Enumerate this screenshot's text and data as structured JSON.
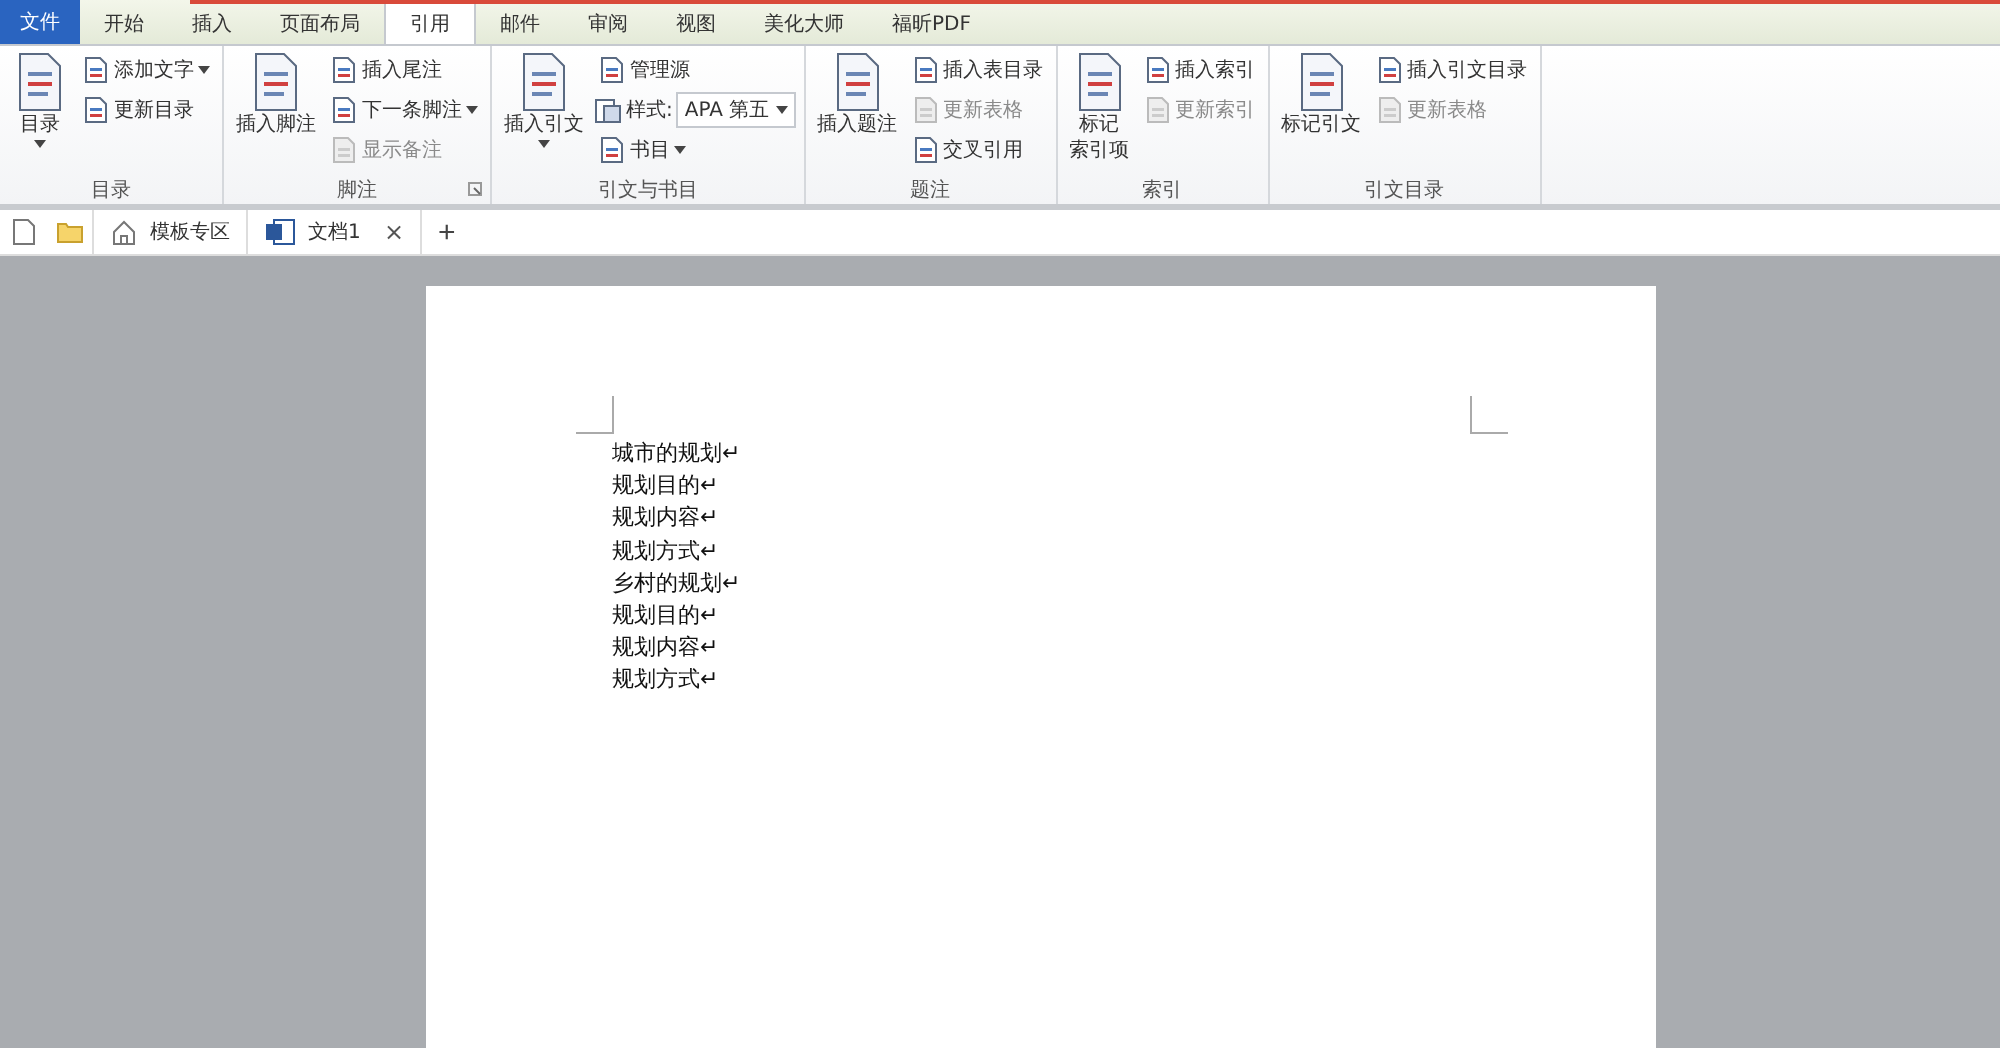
{
  "tabs": [
    {
      "label": "文件",
      "kind": "file",
      "selected": false
    },
    {
      "label": "开始",
      "kind": "tab",
      "selected": false
    },
    {
      "label": "插入",
      "kind": "tab",
      "selected": false
    },
    {
      "label": "页面布局",
      "kind": "tab",
      "selected": false
    },
    {
      "label": "引用",
      "kind": "tab",
      "selected": true
    },
    {
      "label": "邮件",
      "kind": "tab",
      "selected": false
    },
    {
      "label": "审阅",
      "kind": "tab",
      "selected": false
    },
    {
      "label": "视图",
      "kind": "tab",
      "selected": false
    },
    {
      "label": "美化大师",
      "kind": "tab",
      "selected": false
    },
    {
      "label": "福昕PDF",
      "kind": "tab",
      "selected": false
    }
  ],
  "groups": [
    {
      "label": "目录",
      "launcher": false,
      "columns": [
        [
          {
            "kind": "large",
            "lines": [
              "目录"
            ],
            "dropdown": true,
            "disabled": false
          }
        ],
        [
          {
            "kind": "small",
            "label": "添加文字",
            "dropdown": true,
            "disabled": false
          },
          {
            "kind": "small",
            "label": "更新目录",
            "dropdown": false,
            "disabled": false
          }
        ]
      ]
    },
    {
      "label": "脚注",
      "launcher": true,
      "columns": [
        [
          {
            "kind": "large",
            "lines": [
              "插入脚注"
            ],
            "dropdown": false,
            "disabled": false
          }
        ],
        [
          {
            "kind": "small",
            "label": "插入尾注",
            "dropdown": false,
            "disabled": false
          },
          {
            "kind": "small",
            "label": "下一条脚注",
            "dropdown": true,
            "disabled": false
          },
          {
            "kind": "small",
            "label": "显示备注",
            "dropdown": false,
            "disabled": true
          }
        ]
      ]
    },
    {
      "label": "引文与书目",
      "launcher": false,
      "columns": [
        [
          {
            "kind": "large",
            "lines": [
              "插入引文"
            ],
            "dropdown": true,
            "disabled": false
          }
        ],
        [
          {
            "kind": "small",
            "label": "管理源",
            "dropdown": false,
            "disabled": false
          },
          {
            "kind": "select",
            "label": "样式:",
            "value": "APA 第五",
            "dropdown": true
          },
          {
            "kind": "small",
            "label": "书目",
            "dropdown": true,
            "disabled": false
          }
        ]
      ]
    },
    {
      "label": "题注",
      "launcher": false,
      "columns": [
        [
          {
            "kind": "large",
            "lines": [
              "插入题注"
            ],
            "dropdown": false,
            "disabled": false
          }
        ],
        [
          {
            "kind": "small",
            "label": "插入表目录",
            "dropdown": false,
            "disabled": false
          },
          {
            "kind": "small",
            "label": "更新表格",
            "dropdown": false,
            "disabled": true
          },
          {
            "kind": "small",
            "label": "交叉引用",
            "dropdown": false,
            "disabled": false
          }
        ]
      ]
    },
    {
      "label": "索引",
      "launcher": false,
      "columns": [
        [
          {
            "kind": "large",
            "lines": [
              "标记",
              "索引项"
            ],
            "dropdown": false,
            "disabled": false
          }
        ],
        [
          {
            "kind": "small",
            "label": "插入索引",
            "dropdown": false,
            "disabled": false
          },
          {
            "kind": "small",
            "label": "更新索引",
            "dropdown": false,
            "disabled": true
          }
        ]
      ]
    },
    {
      "label": "引文目录",
      "launcher": false,
      "columns": [
        [
          {
            "kind": "large",
            "lines": [
              "标记引文"
            ],
            "dropdown": false,
            "disabled": false
          }
        ],
        [
          {
            "kind": "small",
            "label": "插入引文目录",
            "dropdown": false,
            "disabled": false
          },
          {
            "kind": "small",
            "label": "更新表格",
            "dropdown": false,
            "disabled": true
          }
        ]
      ]
    }
  ],
  "doc_tabs": [
    {
      "label": "模板专区",
      "kind": "home",
      "selected": false
    },
    {
      "label": "文档1",
      "kind": "doc",
      "selected": true,
      "close": "×"
    }
  ],
  "new_tab": "+",
  "document": {
    "lines": [
      "城市的规划↵",
      "规划目的↵",
      "规划内容↵",
      "规划方式↵",
      "乡村的规划↵",
      "规划目的↵",
      "规划内容↵",
      "规划方式↵"
    ]
  }
}
